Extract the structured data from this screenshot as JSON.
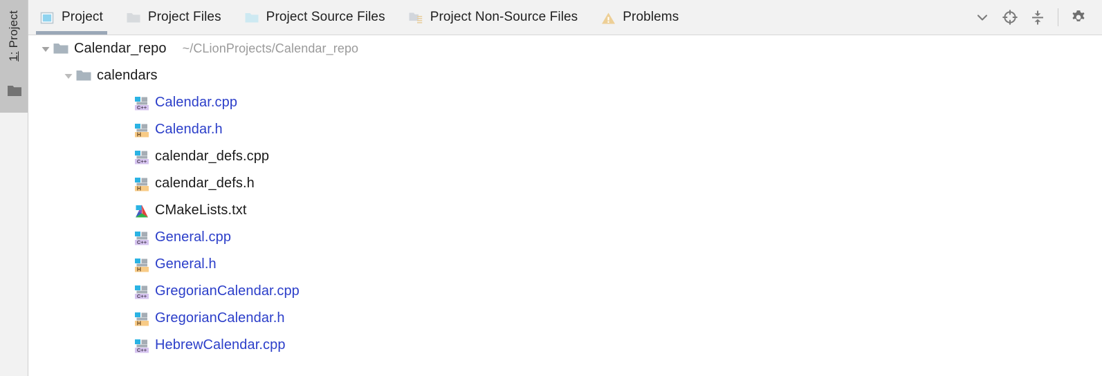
{
  "tool_strip": {
    "label_number": "1:",
    "label_text": " Project",
    "folder_icon": "folder-icon"
  },
  "tabs": [
    {
      "label": "Project",
      "icon": "project-module-icon",
      "active": true
    },
    {
      "label": "Project Files",
      "icon": "folder-grey-icon",
      "active": false
    },
    {
      "label": "Project Source Files",
      "icon": "folder-blue-icon",
      "active": false
    },
    {
      "label": "Project Non-Source Files",
      "icon": "folder-nonsource-icon",
      "active": false
    },
    {
      "label": "Problems",
      "icon": "warning-triangle-icon",
      "active": false
    }
  ],
  "toolbar_buttons": [
    {
      "name": "chevron-down-icon",
      "title": "Show Options Menu"
    },
    {
      "name": "locate-target-icon",
      "title": "Select Opened File"
    },
    {
      "name": "collapse-all-icon",
      "title": "Collapse All"
    },
    {
      "name": "settings-gear-icon",
      "title": "Settings"
    }
  ],
  "tree": [
    {
      "indent": 0,
      "twisty": "expanded",
      "icon": "folder-module-icon",
      "label": "Calendar_repo",
      "sub": "~/CLionProjects/Calendar_repo",
      "vcs": false
    },
    {
      "indent": 1,
      "twisty": "expanded",
      "icon": "folder-module-icon",
      "label": "calendars",
      "sub": "",
      "vcs": false
    },
    {
      "indent": 2,
      "twisty": "none",
      "icon": "cpp-file-icon",
      "label": "Calendar.cpp",
      "sub": "",
      "vcs": true
    },
    {
      "indent": 2,
      "twisty": "none",
      "icon": "header-file-icon",
      "label": "Calendar.h",
      "sub": "",
      "vcs": true
    },
    {
      "indent": 2,
      "twisty": "none",
      "icon": "cpp-file-icon",
      "label": "calendar_defs.cpp",
      "sub": "",
      "vcs": false
    },
    {
      "indent": 2,
      "twisty": "none",
      "icon": "header-file-icon",
      "label": "calendar_defs.h",
      "sub": "",
      "vcs": false
    },
    {
      "indent": 2,
      "twisty": "none",
      "icon": "cmake-file-icon",
      "label": "CMakeLists.txt",
      "sub": "",
      "vcs": false
    },
    {
      "indent": 2,
      "twisty": "none",
      "icon": "cpp-file-icon",
      "label": "General.cpp",
      "sub": "",
      "vcs": true
    },
    {
      "indent": 2,
      "twisty": "none",
      "icon": "header-file-icon",
      "label": "General.h",
      "sub": "",
      "vcs": true
    },
    {
      "indent": 2,
      "twisty": "none",
      "icon": "cpp-file-icon",
      "label": "GregorianCalendar.cpp",
      "sub": "",
      "vcs": true
    },
    {
      "indent": 2,
      "twisty": "none",
      "icon": "header-file-icon",
      "label": "GregorianCalendar.h",
      "sub": "",
      "vcs": true
    },
    {
      "indent": 2,
      "twisty": "none",
      "icon": "cpp-file-icon",
      "label": "HebrewCalendar.cpp",
      "sub": "",
      "vcs": true
    }
  ],
  "colors": {
    "vcs_blue": "#2b3ec9",
    "text": "#1a1a1a",
    "path_grey": "#9a9a9a",
    "tabbar_bg": "#f2f2f2",
    "active_tab_underline": "#9aa7b7",
    "cpp_badge": "#d5c3ef",
    "header_badge": "#f8cb86",
    "warning_orange": "#edcf96"
  }
}
